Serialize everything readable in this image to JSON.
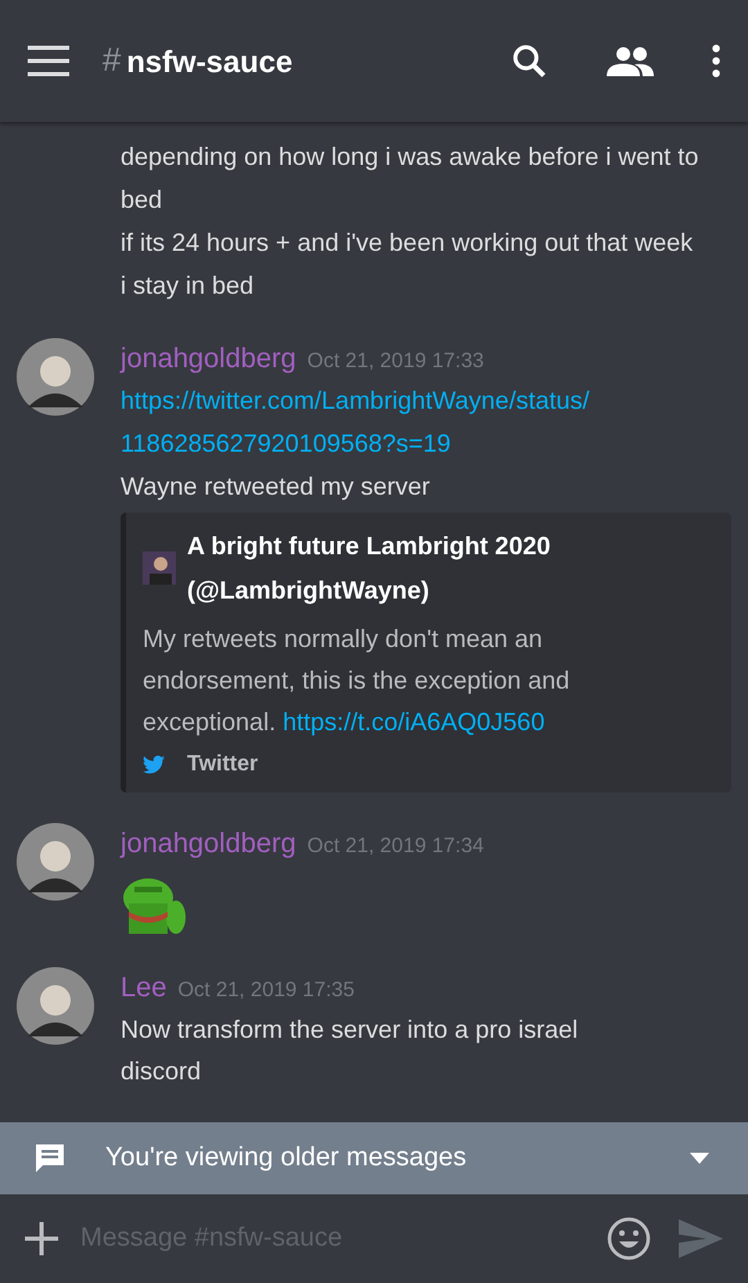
{
  "header": {
    "hash": "#",
    "channel": "nsfw-sauce"
  },
  "messages": [
    {
      "kind": "continuation",
      "lines": [
        "depending on how long i was awake before i went to bed",
        "if its 24 hours + and i've been working out that week i stay in bed"
      ]
    },
    {
      "kind": "message",
      "author": "jonahgoldberg",
      "timestamp": "Oct 21, 2019 17:33",
      "link_lines": [
        "https://twitter.com/LambrightWayne/status/",
        "1186285627920109568?s=19"
      ],
      "lines": [
        "Wayne retweeted my server"
      ],
      "embed": {
        "title": "A bright future Lambright 2020 (@LambrightWayne)",
        "description": "My retweets normally don't mean an endorsement, this is the exception and exceptional.",
        "description_link": "https://t.co/iA6AQ0J560",
        "footer": "Twitter"
      }
    },
    {
      "kind": "sticker",
      "author": "jonahgoldberg",
      "timestamp": "Oct 21, 2019 17:34"
    },
    {
      "kind": "message",
      "author": "Lee",
      "timestamp": "Oct 21, 2019 17:35",
      "lines": [
        "Now transform the server into a pro israel discord"
      ]
    }
  ],
  "banner": {
    "text": "You're viewing older messages"
  },
  "composer": {
    "placeholder": "Message #nsfw-sauce"
  }
}
